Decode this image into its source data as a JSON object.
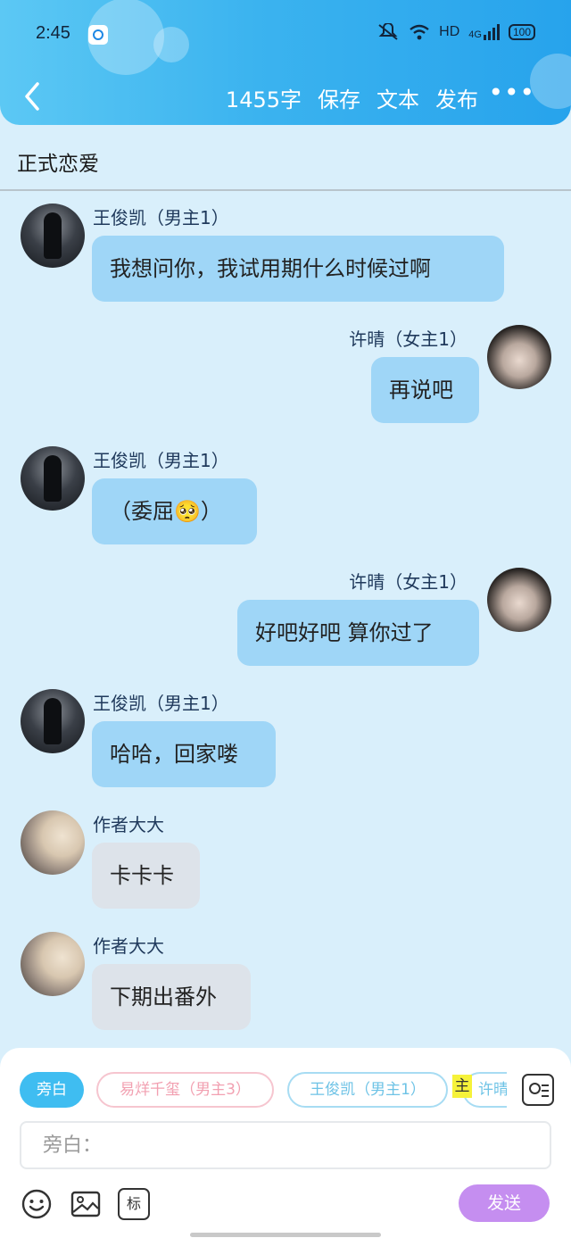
{
  "status_bar": {
    "time": "2:45",
    "network": "HD",
    "signal": "4G",
    "battery": "100"
  },
  "toolbar": {
    "word_count": "1455字",
    "save": "保存",
    "text": "文本",
    "publish": "发布",
    "more": "•••"
  },
  "chapter_title": "正式恋爱",
  "messages": [
    {
      "name": "王俊凯（男主1）",
      "text": "我想问你，我试用期什么时候过啊"
    },
    {
      "name": "许晴（女主1）",
      "text": "再说吧"
    },
    {
      "name": "王俊凯（男主1）",
      "text": "（委屈🥺）"
    },
    {
      "name": "许晴（女主1）",
      "text": "好吧好吧 算你过了"
    },
    {
      "name": "王俊凯（男主1）",
      "text": "哈哈，回家喽"
    },
    {
      "name": "作者大大",
      "text": "卡卡卡"
    },
    {
      "name": "作者大大",
      "text": "下期出番外"
    }
  ],
  "composer": {
    "chips": [
      "旁白",
      "易烊千玺（男主3）",
      "王俊凯（男主1）",
      "许晴"
    ],
    "highlight_char": "主",
    "input_placeholder": "旁白：",
    "icons": [
      "emoji-icon",
      "image-icon",
      "tag-icon",
      "contact-card-icon"
    ],
    "tag_label": "标",
    "send": "发送"
  },
  "colors": {
    "header": "#27a3ec",
    "bubble_blue": "#9fd6f7",
    "bubble_grey": "#dde3ea",
    "send": "#c58ef0"
  }
}
